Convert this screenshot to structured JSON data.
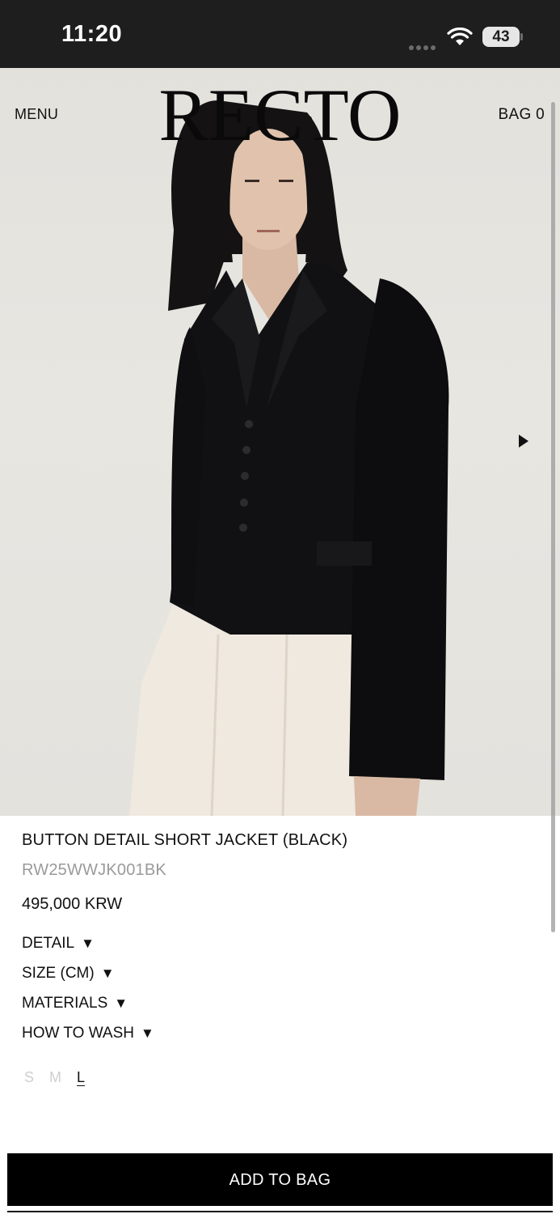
{
  "status_bar": {
    "time": "11:20",
    "battery": "43",
    "icons": [
      "signal-dots-icon",
      "wifi-icon",
      "battery-icon"
    ]
  },
  "header": {
    "menu_label": "MENU",
    "brand": "RECTO",
    "bag_label": "BAG 0"
  },
  "gallery": {
    "next_icon": "triangle-right-icon"
  },
  "product": {
    "title": "BUTTON DETAIL SHORT JACKET (BLACK)",
    "sku": "RW25WWJK001BK",
    "price": "495,000 KRW",
    "sections": [
      {
        "label": "DETAIL",
        "caret": "▼"
      },
      {
        "label": "SIZE (CM)",
        "caret": "▼"
      },
      {
        "label": "MATERIALS",
        "caret": "▼"
      },
      {
        "label": "HOW TO WASH",
        "caret": "▼"
      }
    ],
    "sizes": [
      {
        "label": "S",
        "available": false
      },
      {
        "label": "M",
        "available": false
      },
      {
        "label": "L",
        "available": true,
        "selected": true
      }
    ]
  },
  "cta": {
    "add_to_bag": "ADD TO BAG"
  },
  "colors": {
    "status_bar_bg": "#1e1e1e",
    "accent": "#000000",
    "sku_gray": "#9a9a9a",
    "unavailable_size": "#cfcfcf"
  }
}
